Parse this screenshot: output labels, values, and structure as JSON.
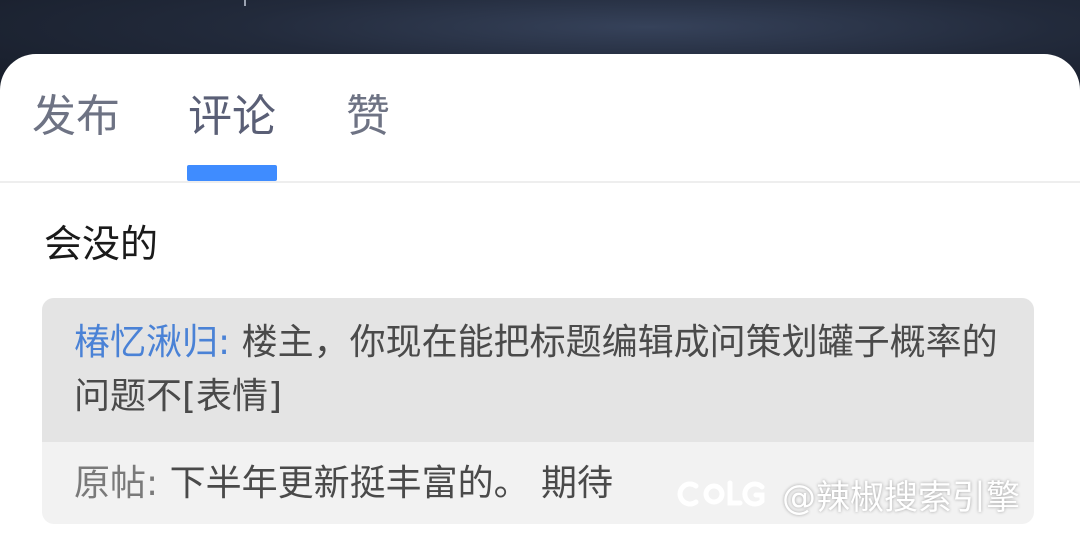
{
  "tabs": [
    {
      "label": "发布"
    },
    {
      "label": "评论"
    },
    {
      "label": "赞"
    }
  ],
  "active_tab": "评论",
  "comment": {
    "text": "会没的"
  },
  "reply": {
    "author": "椿忆湫归:",
    "text": "楼主，你现在能把标题编辑成问策划罐子概率的问题不[表情]"
  },
  "original_post": {
    "label": "原帖:",
    "text": "下半年更新挺丰富的。 期待"
  },
  "watermark": {
    "logo": "colg-logo",
    "text": "@辣椒搜索引擎"
  },
  "colors": {
    "accent": "#3f8cff",
    "author": "#4a82d6"
  }
}
